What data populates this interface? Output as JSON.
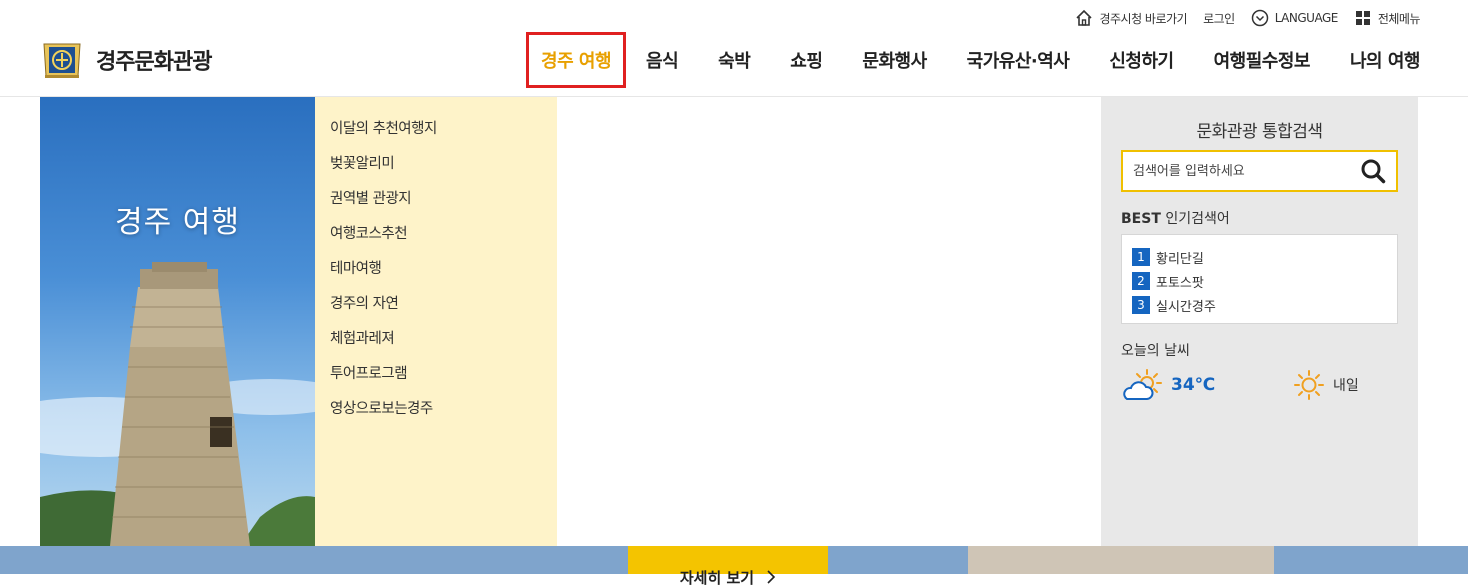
{
  "utility": {
    "city_hall": "경주시청 바로가기",
    "login": "로그인",
    "language": "LANGUAGE",
    "all_menu": "전체메뉴"
  },
  "logo": {
    "text": "경주문화관광"
  },
  "gnb": [
    "경주 여행",
    "음식",
    "숙박",
    "쇼핑",
    "문화행사",
    "국가유산·역사",
    "신청하기",
    "여행필수정보",
    "나의 여행"
  ],
  "panel": {
    "title": "경주 여행",
    "links": [
      "이달의 추천여행지",
      "벚꽃알리미",
      "권역별 관광지",
      "여행코스추천",
      "테마여행",
      "경주의 자연",
      "체험과레져",
      "투어프로그램",
      "영상으로보는경주"
    ]
  },
  "search": {
    "title": "문화관광 통합검색",
    "placeholder": "검색어를 입력하세요",
    "best_strong": "BEST",
    "best_label": "인기검색어",
    "best": [
      {
        "num": "1",
        "term": "황리단길"
      },
      {
        "num": "2",
        "term": "포토스팟"
      },
      {
        "num": "3",
        "term": "실시간경주"
      }
    ]
  },
  "weather": {
    "title": "오늘의 날씨",
    "today_temp": "34℃",
    "tomorrow_label": "내일"
  },
  "more": {
    "label": "자세히 보기"
  },
  "colors": {
    "accent": "#e8a000",
    "highlight_border": "#e02020",
    "link_bg": "#fef3c9",
    "side_bg": "#e8e8e8",
    "rank_blue": "#1565c0"
  }
}
